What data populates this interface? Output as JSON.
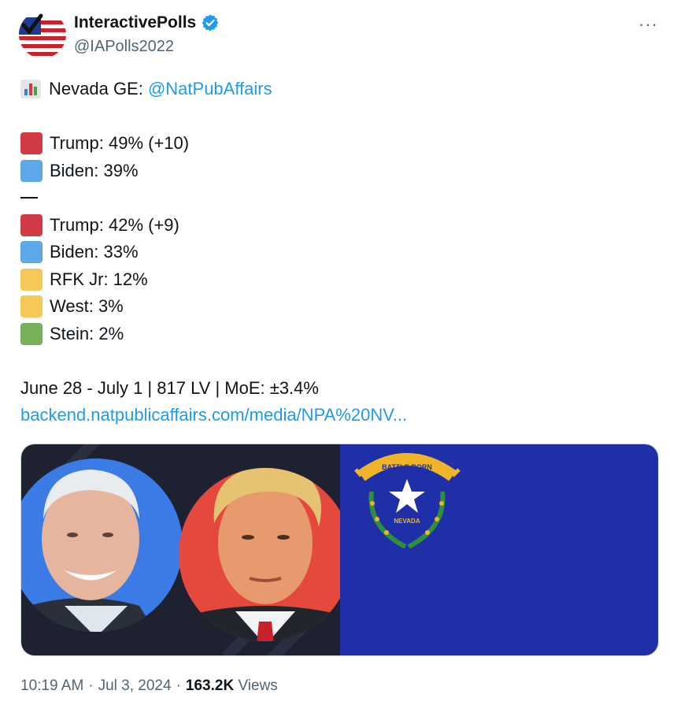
{
  "author": {
    "display_name": "InteractivePolls",
    "handle": "@IAPolls2022",
    "verified_icon": "verified-badge-icon",
    "more_label": "···"
  },
  "tweet": {
    "header_emoji": "bar-chart-icon",
    "header_text": "Nevada GE: ",
    "mention": "@NatPubAffairs",
    "poll1": [
      {
        "label": "Trump: 49% (+10)",
        "color": "#d23b46"
      },
      {
        "label": "Biden: 39%",
        "color": "#5da8e8"
      }
    ],
    "poll2": [
      {
        "label": "Trump: 42% (+9)",
        "color": "#d23b46"
      },
      {
        "label": "Biden: 33%",
        "color": "#5da8e8"
      },
      {
        "label": "RFK Jr: 12%",
        "color": "#f6c859"
      },
      {
        "label": "West: 3%",
        "color": "#f6c859"
      },
      {
        "label": "Stein: 2%",
        "color": "#79b05a"
      }
    ],
    "dates_line": "June 28 - July 1 | 817 LV | MoE: ±3.4%",
    "link": "backend.natpublicaffairs.com/media/NPA%20NV..."
  },
  "media": {
    "flag_banner_top": "BATTLE BORN",
    "flag_banner_bottom": "NEVADA"
  },
  "meta": {
    "time": "10:19 AM",
    "sep1": "·",
    "date": "Jul 3, 2024",
    "sep2": "·",
    "views_count": "163.2K",
    "views_label": "Views"
  }
}
